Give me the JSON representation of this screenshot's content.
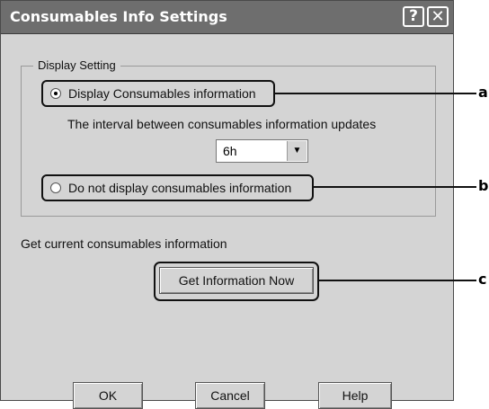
{
  "window": {
    "title": "Consumables Info Settings",
    "help_glyph": "?",
    "close_glyph": "✕"
  },
  "display_setting": {
    "group_label": "Display Setting",
    "option_display": {
      "label": "Display Consumables information",
      "selected": true
    },
    "interval_label": "The interval between consumables information updates",
    "interval_select": {
      "value": "6h",
      "arrow_icon": "triangle-down"
    },
    "option_hide": {
      "label": "Do not display consumables information",
      "selected": false
    }
  },
  "get_info": {
    "label": "Get current consumables information",
    "button_label": "Get Information Now"
  },
  "buttons": {
    "ok": "OK",
    "cancel": "Cancel",
    "help": "Help"
  },
  "callouts": [
    "a",
    "b",
    "c"
  ],
  "colors": {
    "titlebar": "#6e6e6e",
    "dialog_bg": "#d4d4d4"
  }
}
